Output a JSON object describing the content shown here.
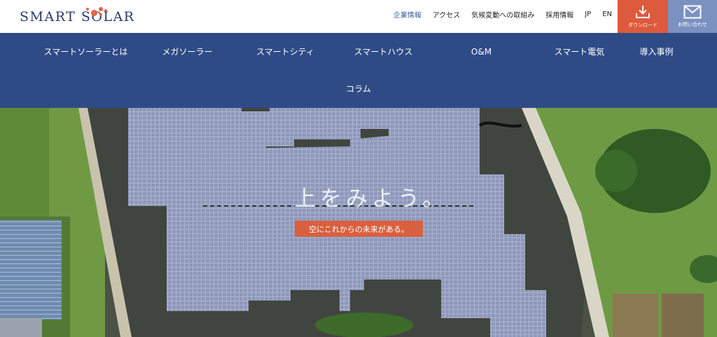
{
  "logo": {
    "text": "SMART SOLAR"
  },
  "util_nav": [
    {
      "label": "企業情報",
      "active": true
    },
    {
      "label": "アクセス",
      "active": false
    },
    {
      "label": "気候変動への取組み",
      "active": false
    },
    {
      "label": "採用情報",
      "active": false
    },
    {
      "label": "JP",
      "active": false
    },
    {
      "label": "EN",
      "active": false
    }
  ],
  "buttons": {
    "download": {
      "label": "ダウンロード",
      "icon": "download-icon"
    },
    "contact": {
      "label": "お問い合わせ",
      "icon": "mail-icon"
    }
  },
  "main_nav": [
    {
      "label": "スマートソーラーとは"
    },
    {
      "label": "メガソーラー"
    },
    {
      "label": "スマートシティ"
    },
    {
      "label": "スマートハウス"
    },
    {
      "label": "O&M"
    },
    {
      "label": "スマート電気"
    },
    {
      "label": "導入事例"
    },
    {
      "label": "コラム"
    }
  ],
  "hero": {
    "headline": "上をみよう。",
    "tagline": "空にこれからの未来がある。"
  },
  "colors": {
    "brand_navy": "#2f4b86",
    "logo_text": "#253a6f",
    "accent_orange": "#de5a3c",
    "contact_blue": "#7b91c0",
    "active_link": "#3c5f9e"
  }
}
